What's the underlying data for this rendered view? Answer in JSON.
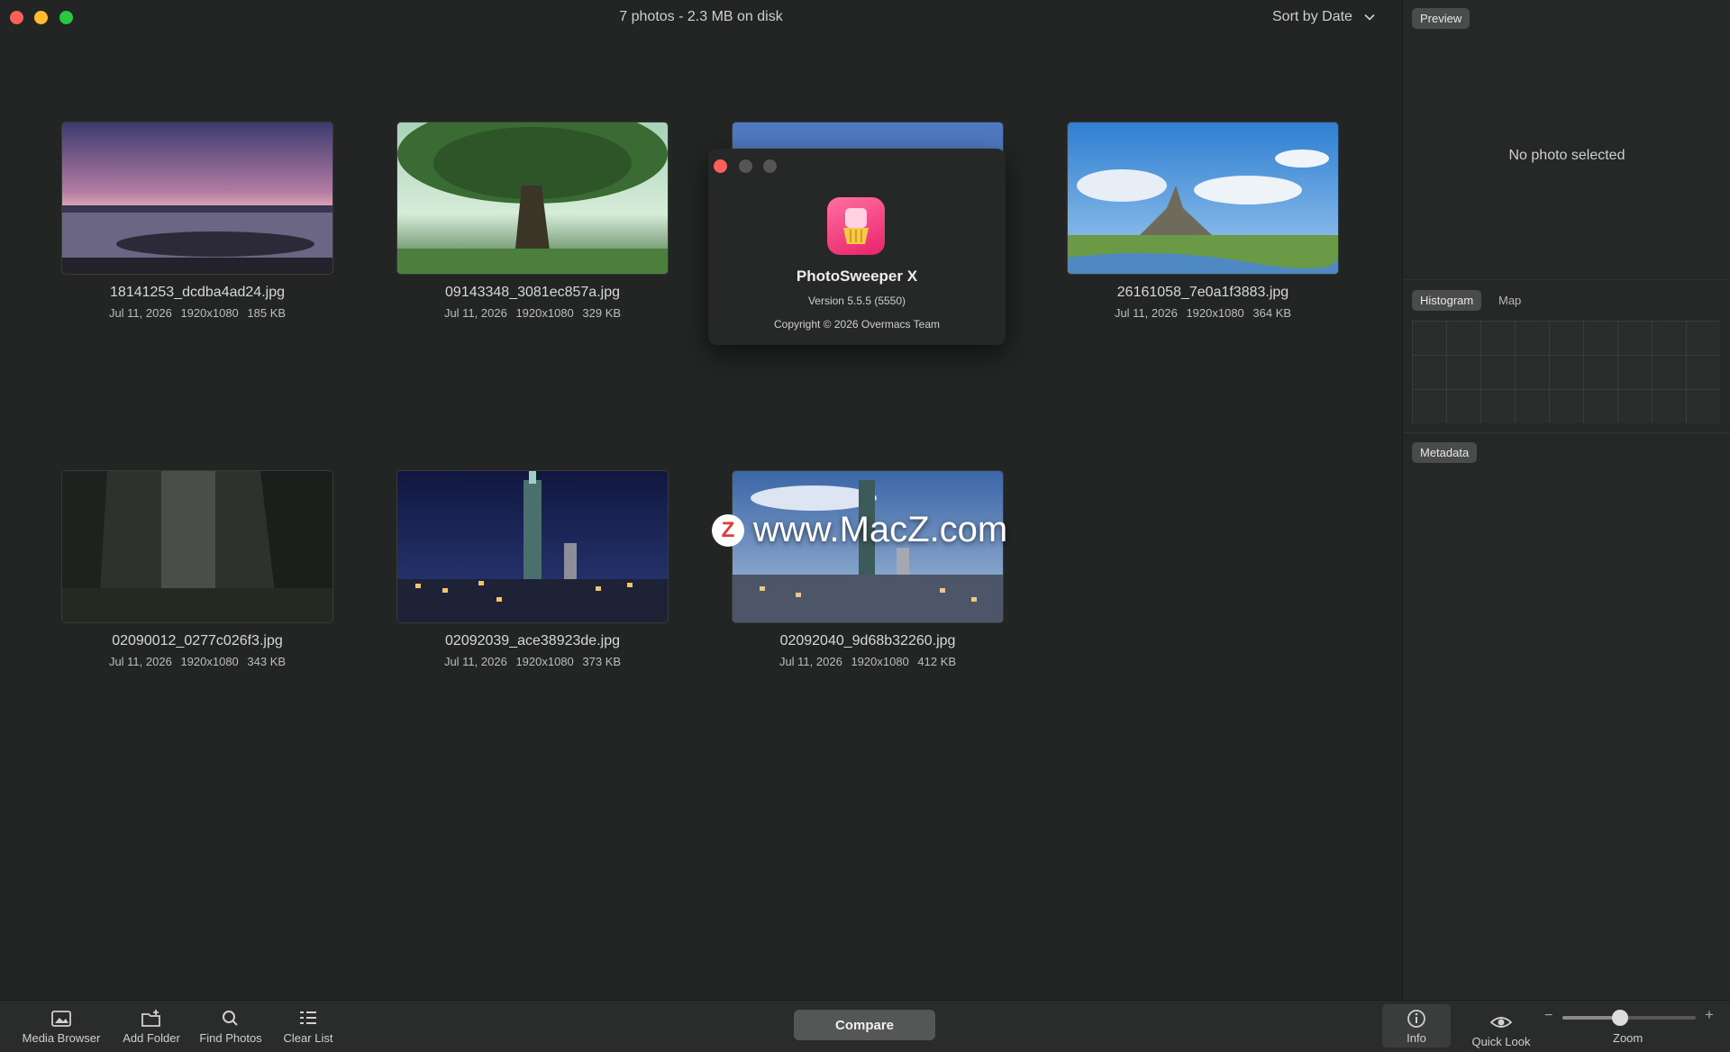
{
  "window": {
    "title": "7 photos - 2.3 MB on disk",
    "sort_label": "Sort by Date"
  },
  "photos": [
    {
      "name": "18141253_dcdba4ad24.jpg",
      "date": "Jul 11, 2026",
      "dims": "1920x1080",
      "size": "185 KB"
    },
    {
      "name": "09143348_3081ec857a.jpg",
      "date": "Jul 11, 2026",
      "dims": "1920x1080",
      "size": "329 KB"
    },
    {
      "name": "26161058_7e0a1f3883.jpg",
      "date": "Jul 11, 2026",
      "dims": "1920x1080",
      "size": "364 KB"
    },
    {
      "name": "02090012_0277c026f3.jpg",
      "date": "Jul 11, 2026",
      "dims": "1920x1080",
      "size": "343 KB"
    },
    {
      "name": "02092039_ace38923de.jpg",
      "date": "Jul 11, 2026",
      "dims": "1920x1080",
      "size": "373 KB"
    },
    {
      "name": "02092040_9d68b32260.jpg",
      "date": "Jul 11, 2026",
      "dims": "1920x1080",
      "size": "412 KB"
    }
  ],
  "about": {
    "app_name": "PhotoSweeper X",
    "version": "Version 5.5.5 (5550)",
    "copyright": "Copyright © 2026 Overmacs Team"
  },
  "watermark": {
    "badge": "Z",
    "text": "www.MacZ.com"
  },
  "sidebar": {
    "preview_tab": "Preview",
    "no_photo": "No photo selected",
    "histogram_tab": "Histogram",
    "map_tab": "Map",
    "metadata_tab": "Metadata"
  },
  "toolbar": {
    "media_browser": "Media Browser",
    "add_folder": "Add Folder",
    "find_photos": "Find Photos",
    "clear_list": "Clear List",
    "compare": "Compare",
    "info": "Info",
    "quick_look": "Quick Look",
    "zoom": "Zoom",
    "zoom_minus": "−",
    "zoom_plus": "+",
    "zoom_level": 0.42
  },
  "colors": {
    "background": "#232424",
    "sidebar": "#262727",
    "accent_close": "#ff5f57",
    "accent_min": "#febc2e",
    "accent_max": "#28c840"
  }
}
